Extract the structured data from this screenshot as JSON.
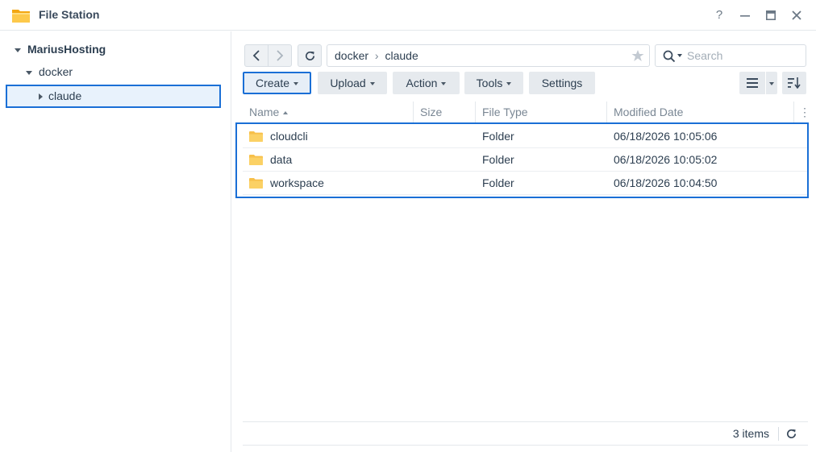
{
  "window": {
    "title": "File Station",
    "help_label": "?",
    "minimize_label": "—",
    "maximize_label": "▣",
    "close_label": "✕"
  },
  "sidebar": {
    "root": "MariusHosting",
    "items": [
      {
        "label": "docker"
      },
      {
        "label": "claude",
        "selected": true
      }
    ]
  },
  "path": {
    "segments": [
      "docker",
      "claude"
    ],
    "separator": "›"
  },
  "search": {
    "placeholder": "Search"
  },
  "toolbar": {
    "create": "Create",
    "upload": "Upload",
    "action": "Action",
    "tools": "Tools",
    "settings": "Settings"
  },
  "columns": {
    "name": "Name",
    "size": "Size",
    "type": "File Type",
    "modified": "Modified Date"
  },
  "files": [
    {
      "name": "cloudcli",
      "size": "",
      "type": "Folder",
      "modified": "06/18/2026 10:05:06"
    },
    {
      "name": "data",
      "size": "",
      "type": "Folder",
      "modified": "06/18/2026 10:05:02"
    },
    {
      "name": "workspace",
      "size": "",
      "type": "Folder",
      "modified": "06/18/2026 10:04:50"
    }
  ],
  "footer": {
    "count": "3 items"
  },
  "colors": {
    "accent": "#1a6fd6",
    "folder": "#f7c04a",
    "selected_bg": "#e8f2fc"
  },
  "icons": {
    "app": "folder-app-icon",
    "back": "chevron-left-icon",
    "forward": "chevron-right-icon",
    "refresh": "refresh-icon",
    "star": "star-icon",
    "search": "search-icon",
    "list_view": "list-view-icon",
    "sort": "sort-icon",
    "folder": "folder-icon"
  }
}
